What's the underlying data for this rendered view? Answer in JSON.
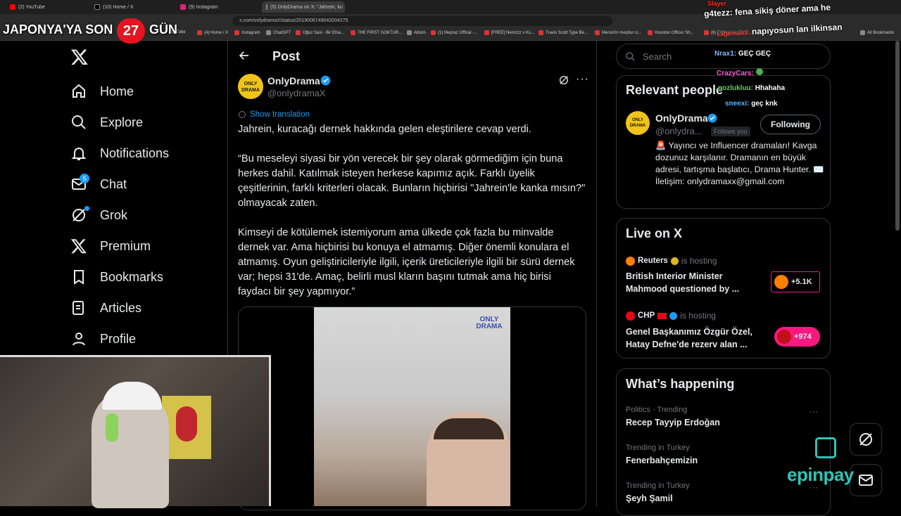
{
  "browser": {
    "tabs": [
      {
        "label": "(2) YouTube"
      },
      {
        "label": "(10) Home / X"
      },
      {
        "label": "(9) Instagram"
      },
      {
        "label": "(5) OnlyDrama on X: \"Jahrein, ku"
      }
    ],
    "url": "x.com/onlydramaX/status/2019006749043204275",
    "bookmarks": [
      "YouTube",
      "(4) Home / X",
      "Instagram",
      "ChatGPT",
      "Oğuz Sasi - Bir Efsa...",
      "THE FIRST GOKTUR...",
      "Albüm",
      "(1) Mepraz Offical -...",
      "[FREE] Nemzzz x Ks...",
      "Travis Scott Type Be...",
      "Mersin'in meşhur ci...",
      "Houston Officer Sh...",
      "(6) Türkiye'nin EN E...",
      "All Bookmarks"
    ]
  },
  "overlay": {
    "banner_left": "JAPONYA'YA SON",
    "banner_num": "27",
    "banner_right": "GÜN",
    "chat": [
      {
        "user": "Slayer_",
        "msg": ""
      },
      {
        "user": "g4tezz:",
        "msg": "fena sikiş döner ama he"
      },
      {
        "user": "kagemas3:",
        "msg": "napıyosun lan ilkinsan"
      },
      {
        "user": "Nrax1:",
        "msg": "GEÇ GEÇ"
      },
      {
        "user": "CrazyCars:",
        "msg": ""
      },
      {
        "user": "gozlukluu:",
        "msg": "Hhahaha"
      },
      {
        "user": "sneexi:",
        "msg": "geç knk"
      }
    ],
    "sponsor": "epinpay"
  },
  "sidebar": {
    "items": [
      {
        "label": "Home",
        "icon": "home-icon"
      },
      {
        "label": "Explore",
        "icon": "search-icon"
      },
      {
        "label": "Notifications",
        "icon": "bell-icon"
      },
      {
        "label": "Chat",
        "icon": "mail-icon",
        "badge": "5"
      },
      {
        "label": "Grok",
        "icon": "grok-icon"
      },
      {
        "label": "Premium",
        "icon": "x-logo-icon"
      },
      {
        "label": "Bookmarks",
        "icon": "bookmark-icon"
      },
      {
        "label": "Articles",
        "icon": "article-icon"
      },
      {
        "label": "Profile",
        "icon": "profile-icon"
      }
    ]
  },
  "post": {
    "header": "Post",
    "author_name": "OnlyDrama",
    "author_handle": "@onlydramaX",
    "avatar_text": "ONLY DRAMA",
    "show_translation": "Show translation",
    "paragraphs": [
      "Jahrein, kuracağı dernek hakkında gelen eleştirilere cevap verdi.",
      "“Bu meseleyi siyasi bir yön verecek bir şey olarak görmediğim için buna herkes dahil. Katılmak isteyen herkese kapımız açık. Farklı üyelik çeşitlerinin, farklı kriterleri olacak. Bunların hiçbirisi \"Jahrein'le kanka mısın?\" olmayacak zaten.",
      "Kimseyi de kötülemek istemiyorum ama ülkede çok fazla bu minvalde dernek var. Ama hiçbirisi bu konuya el atmamış. Diğer önemli konulara el atmamış. Oyun geliştiricileriyle ilgili, içerik üreticileriyle ilgili bir sürü dernek var; hepsi 31'de. Amaç, belirli musl kların başını tutmak ama hiç birisi faydacı bir şey yapmıyor.”"
    ],
    "media_watermark": "ONLY DRAMA"
  },
  "right": {
    "search_placeholder": "Search",
    "relevant": {
      "title": "Relevant people",
      "name": "OnlyDrama",
      "handle": "@onlydra...",
      "follows_you": "Follows you",
      "follow_button": "Following",
      "bio": "🚨 Yayıncı ve Influencer dramaları! Kavga dozunuz karşılanır. Dramanın en büyük adresi, tartışma başlatıcı, Drama Hunter. ✉️ İletişim: onlydramaxx@gmail.com"
    },
    "live": {
      "title": "Live on X",
      "items": [
        {
          "host": "Reuters",
          "hosting": "is hosting",
          "title1": "British Interior Minister",
          "title2": "Mahmood questioned by ...",
          "count": "+5.1K"
        },
        {
          "host": "CHP",
          "hosting": "is hosting",
          "title1": "Genel Başkanımız Özgür Özel,",
          "title2": "Hatay Defne'de rezerv alan ...",
          "count": "+974"
        }
      ]
    },
    "happening": {
      "title": "What’s happening",
      "items": [
        {
          "context": "Politics · Trending",
          "topic": "Recep Tayyip Erdoğan"
        },
        {
          "context": "Trending in Turkey",
          "topic": "Fenerbahçemizin"
        },
        {
          "context": "Trending in Turkey",
          "topic": "Şeyh Şamil"
        }
      ]
    }
  },
  "colors": {
    "accent": "#1d9bf0",
    "verified": "#1d9bf0",
    "live": "#f91880"
  }
}
